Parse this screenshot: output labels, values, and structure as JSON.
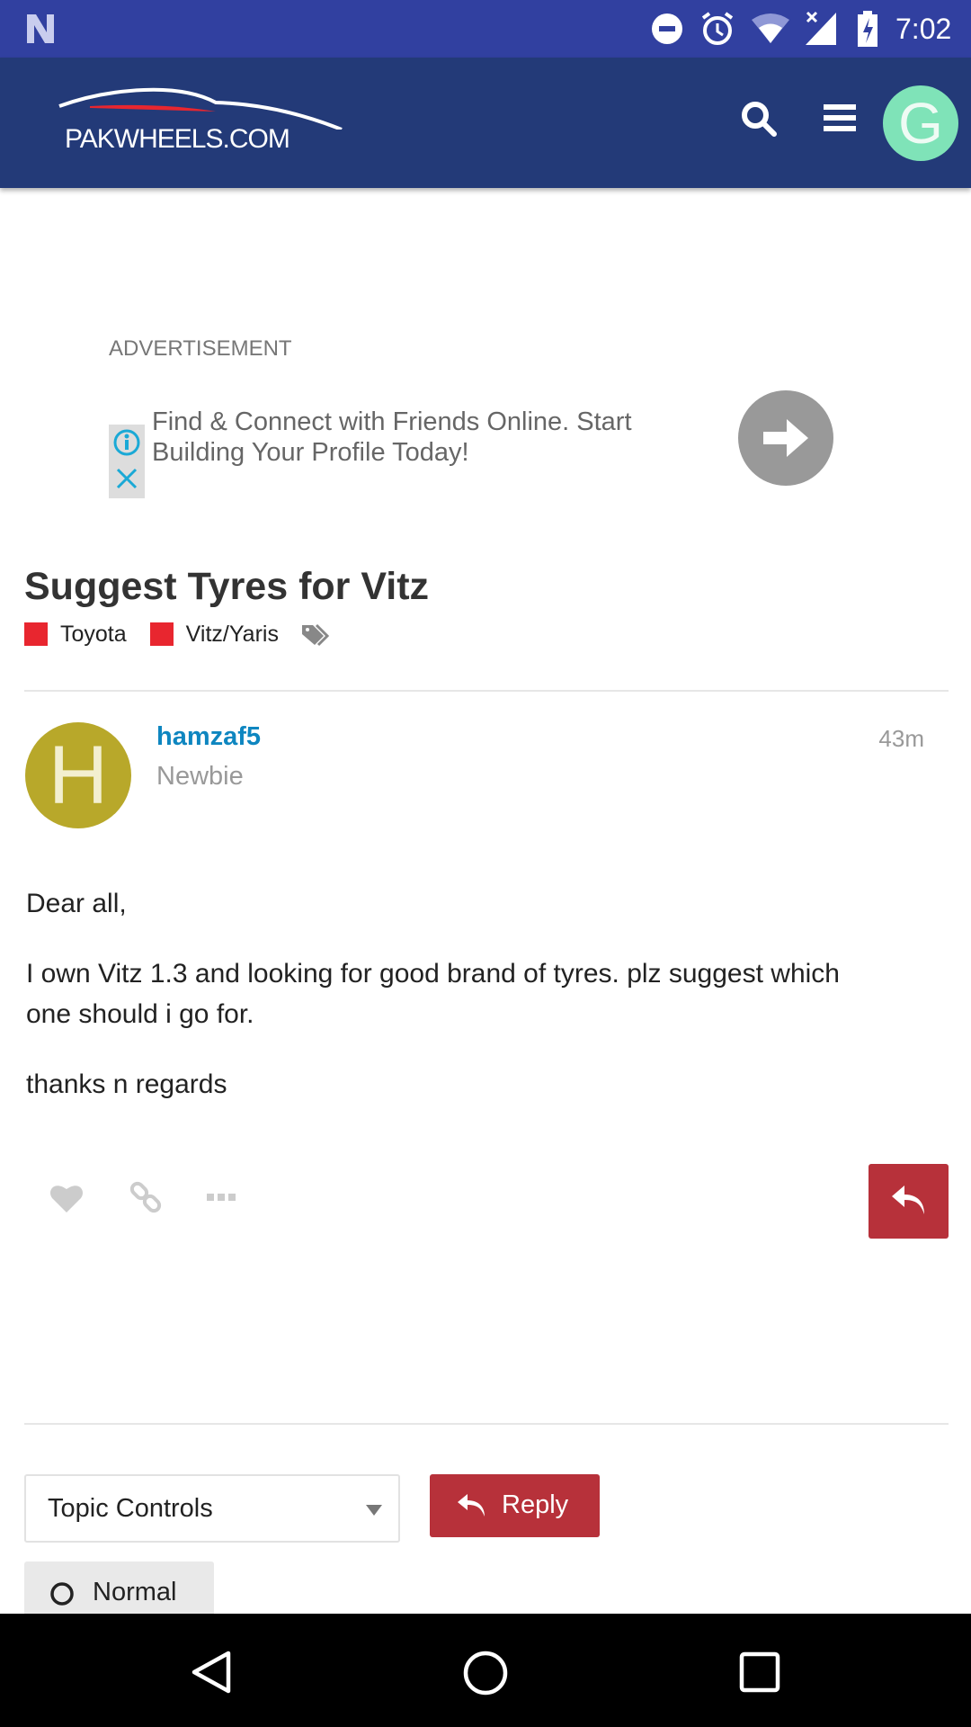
{
  "status_bar": {
    "time": "7:02",
    "icons": [
      "notification-n-icon",
      "do-not-disturb-icon",
      "alarm-icon",
      "wifi-icon",
      "signal-icon",
      "battery-charging-icon"
    ]
  },
  "header": {
    "logo_text": "PAKWHEELS.COM",
    "avatar_letter": "G",
    "avatar_color": "#7fe3b8",
    "background": "#233a78"
  },
  "ad": {
    "label": "ADVERTISEMENT",
    "text_line1": "Find & Connect with Friends Online. Start",
    "text_line2": "Building Your Profile Today!"
  },
  "topic": {
    "title": "Suggest Tyres for Vitz",
    "categories": [
      {
        "name": "Toyota",
        "color": "#e8262f"
      },
      {
        "name": "Vitz/Yaris",
        "color": "#e8262f"
      }
    ]
  },
  "post": {
    "username": "hamzaf5",
    "title": "Newbie",
    "time": "43m",
    "avatar_letter": "H",
    "avatar_color": "#b8a82a",
    "paragraphs": [
      "Dear all,",
      "I own Vitz 1.3 and looking for good brand of tyres. plz suggest which one should i go for.",
      "thanks n regards"
    ]
  },
  "footer": {
    "topic_controls": "Topic Controls",
    "reply": "Reply",
    "notification_level": "Normal",
    "accent": "#b7313a"
  }
}
